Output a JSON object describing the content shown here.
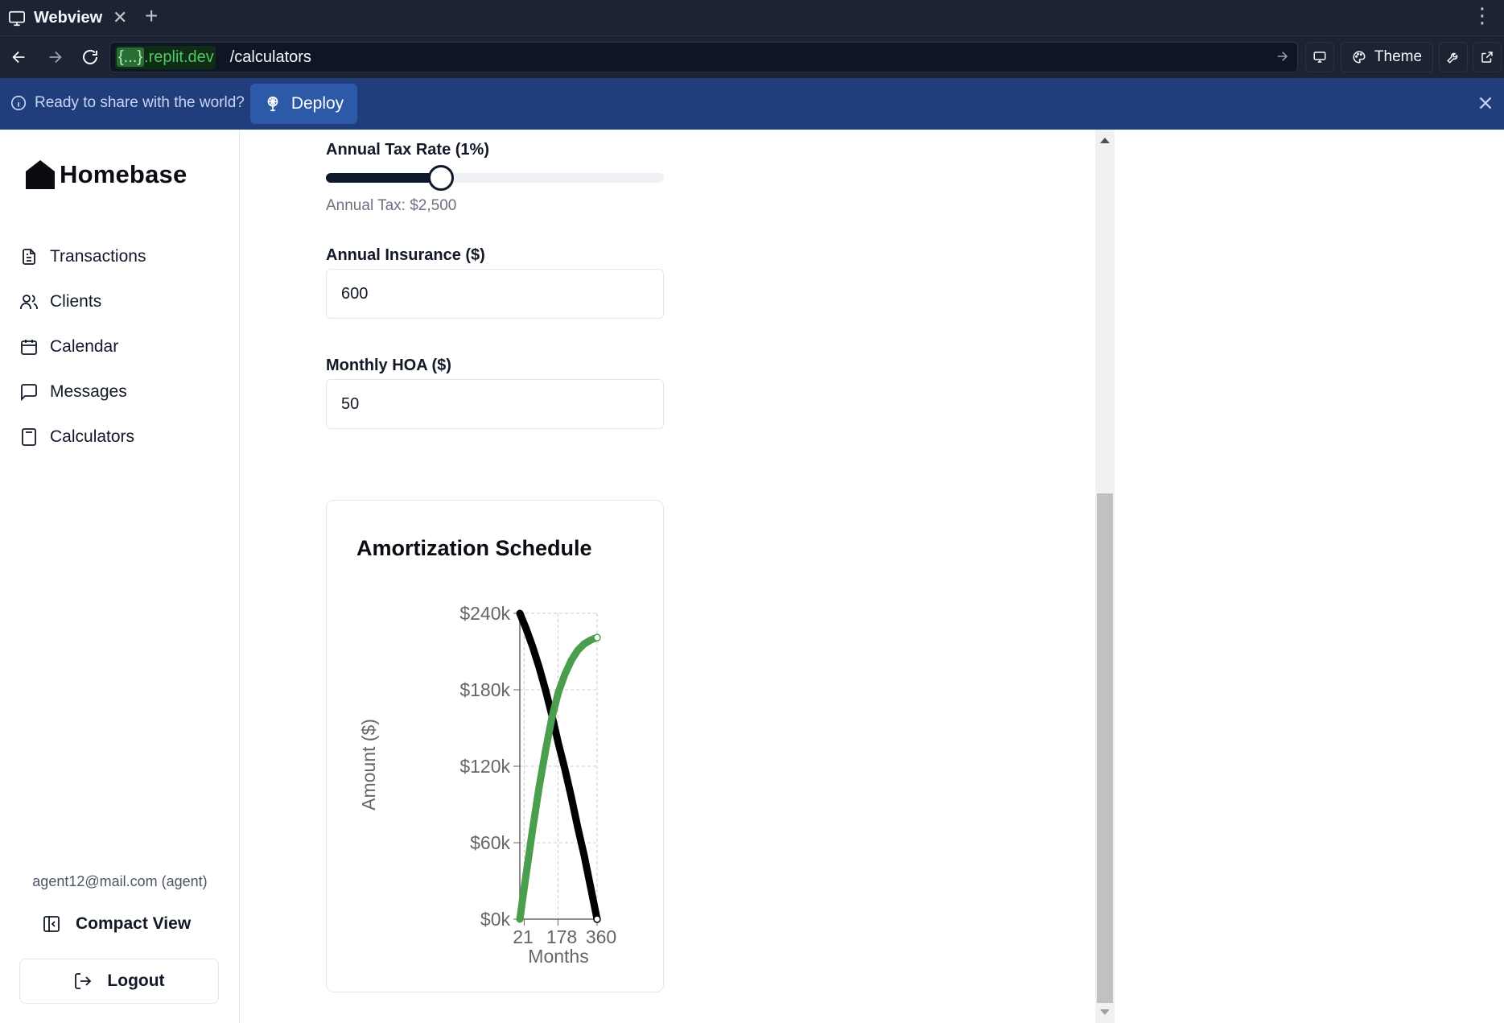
{
  "browser": {
    "tab_title": "Webview",
    "url_host_bracket": "{...}",
    "url_host_rest": ".replit.dev",
    "url_path": "/calculators",
    "theme_label": "Theme"
  },
  "banner": {
    "message": "Ready to share with the world?",
    "deploy_label": "Deploy"
  },
  "sidebar": {
    "logo_text": "Homebase",
    "items": [
      {
        "label": "Transactions",
        "icon": "file-text-icon"
      },
      {
        "label": "Clients",
        "icon": "users-icon"
      },
      {
        "label": "Calendar",
        "icon": "calendar-icon"
      },
      {
        "label": "Messages",
        "icon": "message-square-icon"
      },
      {
        "label": "Calculators",
        "icon": "calculator-icon"
      }
    ],
    "user_email": "agent12@mail.com (agent)",
    "compact_view_label": "Compact View",
    "logout_label": "Logout"
  },
  "form": {
    "tax_rate_label": "Annual Tax Rate (1%)",
    "tax_rate_slider_fraction": 0.34,
    "annual_tax_hint": "Annual Tax: $2,500",
    "insurance_label": "Annual Insurance ($)",
    "insurance_value": "600",
    "hoa_label": "Monthly HOA ($)",
    "hoa_value": "50"
  },
  "chart_data": {
    "type": "line",
    "title": "Amortization Schedule",
    "xlabel": "Months",
    "ylabel": "Amount ($)",
    "x_ticks": [
      "21",
      "178",
      "360"
    ],
    "y_ticks": [
      "$0k",
      "$60k",
      "$120k",
      "$180k",
      "$240k"
    ],
    "xlim": [
      1,
      360
    ],
    "ylim": [
      0,
      240000
    ],
    "grid": true,
    "series": [
      {
        "color": "#000000",
        "x": [
          1,
          30,
          60,
          90,
          120,
          150,
          180,
          210,
          240,
          270,
          300,
          330,
          360
        ],
        "values": [
          240000,
          228000,
          214000,
          198000,
          180000,
          160000,
          138000,
          118000,
          96000,
          72000,
          50000,
          25000,
          0
        ]
      },
      {
        "color": "#4a9e4e",
        "x": [
          1,
          30,
          60,
          90,
          120,
          150,
          180,
          210,
          240,
          270,
          300,
          330,
          360
        ],
        "values": [
          0,
          35000,
          70000,
          103000,
          132000,
          158000,
          178000,
          192000,
          203000,
          211000,
          216000,
          219000,
          221000
        ]
      }
    ]
  }
}
